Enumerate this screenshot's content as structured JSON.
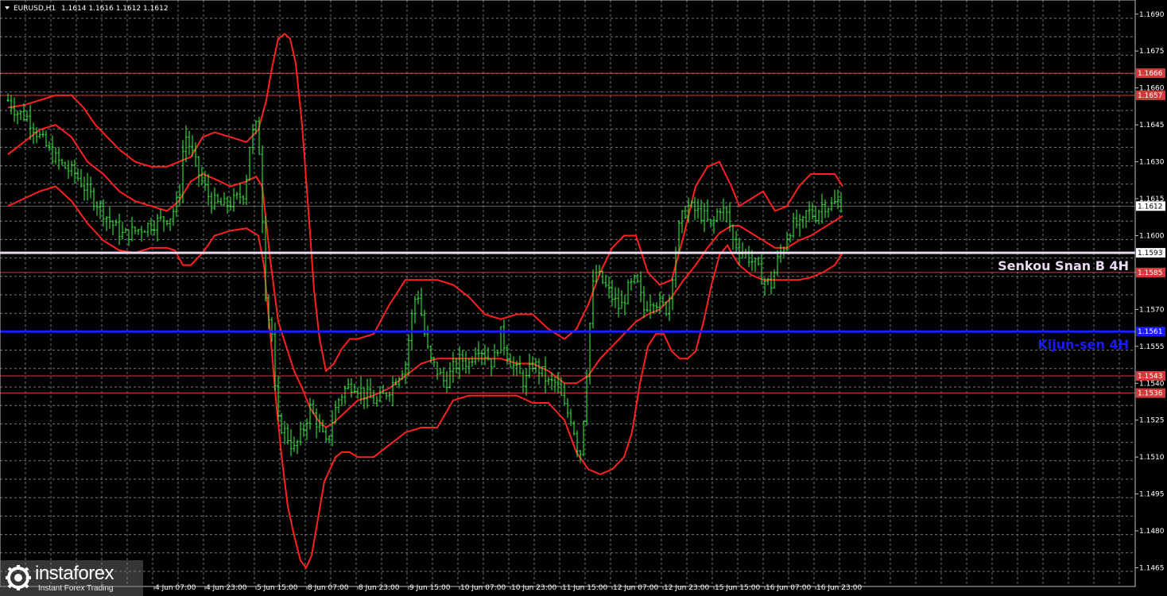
{
  "title_bar": {
    "symbol": "EURUSD,H1",
    "ohlc": "1.1614 1.1616 1.1612 1.1612"
  },
  "colors": {
    "background": "#000000",
    "grid": "#6f7a80",
    "candle": "#33ff44",
    "indicator": "#ff2020",
    "level": "#d23a3a",
    "senkou": "#e8d8f0",
    "kijun": "#1a1aff",
    "axis_text": "#ffffff"
  },
  "chart_data": {
    "type": "line",
    "symbol": "EURUSD",
    "timeframe": "H1",
    "ylim": [
      1.1463,
      1.1705
    ],
    "grid": true,
    "y_ticks": [
      "1.1690",
      "1.1675",
      "1.1660",
      "1.1645",
      "1.1630",
      "1.1615",
      "1.1600",
      "1.1585",
      "1.1570",
      "1.1555",
      "1.1540",
      "1.1525",
      "1.1510",
      "1.1495",
      "1.1480",
      "1.1465"
    ],
    "x_ticks": [
      "4 Jun 07:00",
      "4 Jun 23:00",
      "5 Jun 15:00",
      "8 Jun 07:00",
      "8 Jun 23:00",
      "9 Jun 15:00",
      "10 Jun 07:00",
      "10 Jun 23:00",
      "11 Jun 15:00",
      "12 Jun 07:00",
      "12 Jun 23:00",
      "15 Jun 15:00",
      "16 Jun 07:00",
      "16 Jun 23:00"
    ],
    "price_levels": [
      {
        "value": 1.1666,
        "label": "1.1666",
        "kind": "resistance"
      },
      {
        "value": 1.1657,
        "label": "1.1657",
        "kind": "resistance"
      },
      {
        "value": 1.1585,
        "label": "1.1585",
        "kind": "support"
      },
      {
        "value": 1.1543,
        "label": "1.1543",
        "kind": "support"
      },
      {
        "value": 1.1536,
        "label": "1.1536",
        "kind": "support"
      }
    ],
    "current_price": {
      "value": 1.1612,
      "label": "1.1612"
    },
    "senkou_span_b": {
      "value": 1.1593,
      "label": "1.1593",
      "name": "Senkou Snan B 4H"
    },
    "kijun_sen": {
      "value": 1.1561,
      "label": "1.1561",
      "name": "Kijun-sen 4H"
    },
    "price_series": {
      "x": [
        0,
        12,
        25,
        40,
        55,
        70,
        85,
        100,
        115,
        130,
        145,
        160,
        175,
        190,
        205,
        215,
        222,
        230,
        240,
        255,
        270,
        285,
        298,
        305,
        312,
        318,
        322,
        326,
        332,
        338,
        345,
        352,
        360,
        370,
        380,
        390,
        400,
        408,
        415,
        425,
        435,
        450,
        465,
        480,
        490,
        500,
        510,
        515,
        520,
        525,
        530,
        540,
        550,
        560,
        570,
        580,
        590,
        600,
        610,
        620,
        630,
        640,
        650,
        660,
        670,
        680,
        690,
        700,
        710,
        715,
        720,
        725,
        730,
        735,
        740,
        750,
        760,
        770,
        780,
        790,
        800,
        810,
        820,
        830,
        838,
        845,
        855,
        865,
        875,
        885,
        895,
        905,
        912,
        920,
        930,
        940,
        950,
        960,
        968,
        975,
        982,
        990,
        998,
        1005,
        1015,
        1025,
        1035,
        1045,
        1050
      ],
      "y": [
        1.1655,
        1.165,
        1.1648,
        1.164,
        1.1633,
        1.1628,
        1.1625,
        1.1618,
        1.1612,
        1.1605,
        1.16,
        1.1602,
        1.1604,
        1.1606,
        1.1608,
        1.1615,
        1.1642,
        1.1635,
        1.1625,
        1.1614,
        1.1612,
        1.1614,
        1.1618,
        1.164,
        1.1644,
        1.163,
        1.1585,
        1.157,
        1.156,
        1.1525,
        1.1522,
        1.1518,
        1.1513,
        1.152,
        1.153,
        1.1523,
        1.1515,
        1.1525,
        1.1533,
        1.1538,
        1.154,
        1.1535,
        1.1532,
        1.1538,
        1.1543,
        1.1548,
        1.1572,
        1.1578,
        1.1568,
        1.1558,
        1.155,
        1.1545,
        1.154,
        1.1546,
        1.155,
        1.1548,
        1.1556,
        1.1552,
        1.1548,
        1.156,
        1.155,
        1.1545,
        1.154,
        1.1548,
        1.1545,
        1.154,
        1.154,
        1.153,
        1.1525,
        1.1515,
        1.1512,
        1.153,
        1.1555,
        1.1578,
        1.1585,
        1.158,
        1.1575,
        1.157,
        1.1578,
        1.1582,
        1.157,
        1.1575,
        1.1572,
        1.157,
        1.159,
        1.1605,
        1.1612,
        1.161,
        1.1608,
        1.1603,
        1.1612,
        1.1608,
        1.1598,
        1.1595,
        1.1592,
        1.1588,
        1.1582,
        1.158,
        1.159,
        1.1595,
        1.1602,
        1.1605,
        1.1603,
        1.161,
        1.1608,
        1.1613,
        1.1612,
        1.1614,
        1.1612
      ]
    },
    "indicator_lines": [
      {
        "x": [
          0,
          20,
          40,
          60,
          80,
          95,
          110,
          125,
          140,
          160,
          180,
          200,
          215,
          230,
          245,
          260,
          280,
          300,
          315,
          325,
          332,
          340,
          348,
          355,
          362,
          370,
          378,
          385,
          392,
          400,
          410,
          420,
          430,
          440,
          460,
          480,
          500,
          520,
          540,
          560,
          580,
          600,
          620,
          640,
          660,
          680,
          700,
          715,
          730,
          745,
          760,
          775,
          790,
          805,
          820,
          835,
          850,
          865,
          880,
          895,
          910,
          920,
          935,
          950,
          965,
          980,
          995,
          1010,
          1025,
          1040,
          1050
        ],
        "y": [
          1.1652,
          1.1653,
          1.1655,
          1.1657,
          1.1657,
          1.1652,
          1.1645,
          1.164,
          1.1635,
          1.163,
          1.1628,
          1.1628,
          1.163,
          1.1632,
          1.164,
          1.1642,
          1.164,
          1.1638,
          1.1643,
          1.1655,
          1.1668,
          1.168,
          1.1682,
          1.168,
          1.167,
          1.1645,
          1.161,
          1.1578,
          1.1558,
          1.1545,
          1.1548,
          1.1554,
          1.1558,
          1.1558,
          1.156,
          1.1572,
          1.1582,
          1.1582,
          1.1582,
          1.158,
          1.1575,
          1.1568,
          1.1566,
          1.1568,
          1.1568,
          1.1562,
          1.1558,
          1.1562,
          1.1572,
          1.1585,
          1.1595,
          1.16,
          1.16,
          1.1585,
          1.158,
          1.1582,
          1.16,
          1.162,
          1.1628,
          1.163,
          1.162,
          1.1612,
          1.1615,
          1.1618,
          1.161,
          1.1612,
          1.162,
          1.1625,
          1.1625,
          1.1625,
          1.162
        ]
      },
      {
        "x": [
          0,
          20,
          40,
          60,
          80,
          100,
          120,
          140,
          160,
          180,
          200,
          215,
          230,
          245,
          260,
          280,
          300,
          312,
          320,
          330,
          340,
          350,
          360,
          370,
          380,
          390,
          400,
          410,
          420,
          440,
          460,
          480,
          500,
          520,
          540,
          560,
          580,
          600,
          620,
          640,
          660,
          680,
          700,
          715,
          730,
          745,
          760,
          775,
          790,
          805,
          820,
          835,
          850,
          865,
          880,
          895,
          910,
          920,
          935,
          950,
          965,
          980,
          995,
          1010,
          1025,
          1040,
          1050
        ],
        "y": [
          1.1633,
          1.1638,
          1.1643,
          1.1645,
          1.164,
          1.163,
          1.1625,
          1.1618,
          1.1614,
          1.1612,
          1.161,
          1.1614,
          1.1622,
          1.1625,
          1.1623,
          1.162,
          1.1622,
          1.1624,
          1.162,
          1.159,
          1.1565,
          1.1555,
          1.1545,
          1.1538,
          1.153,
          1.1525,
          1.1522,
          1.1524,
          1.1527,
          1.1533,
          1.1535,
          1.1538,
          1.1543,
          1.1548,
          1.155,
          1.155,
          1.155,
          1.155,
          1.155,
          1.1548,
          1.1548,
          1.1545,
          1.154,
          1.154,
          1.1543,
          1.155,
          1.1555,
          1.156,
          1.1565,
          1.1568,
          1.157,
          1.1575,
          1.1582,
          1.1588,
          1.1595,
          1.1601,
          1.1604,
          1.1604,
          1.1601,
          1.1598,
          1.1595,
          1.1595,
          1.1598,
          1.16,
          1.1603,
          1.1606,
          1.1608
        ]
      },
      {
        "x": [
          0,
          20,
          40,
          60,
          80,
          100,
          120,
          140,
          160,
          180,
          200,
          210,
          220,
          230,
          245,
          260,
          280,
          300,
          315,
          322,
          330,
          338,
          345,
          352,
          360,
          368,
          375,
          382,
          390,
          398,
          405,
          412,
          420,
          430,
          440,
          460,
          480,
          500,
          520,
          540,
          560,
          580,
          600,
          620,
          640,
          660,
          680,
          700,
          715,
          730,
          745,
          760,
          775,
          785,
          795,
          805,
          815,
          825,
          835,
          845,
          855,
          865,
          875,
          885,
          895,
          905,
          912,
          920,
          935,
          950,
          965,
          980,
          995,
          1010,
          1025,
          1040,
          1050
        ],
        "y": [
          1.1612,
          1.1615,
          1.1618,
          1.162,
          1.1614,
          1.1605,
          1.1598,
          1.1594,
          1.1593,
          1.1595,
          1.1595,
          1.1594,
          1.1588,
          1.1588,
          1.1593,
          1.16,
          1.1602,
          1.1603,
          1.16,
          1.1588,
          1.156,
          1.153,
          1.1508,
          1.149,
          1.1478,
          1.1468,
          1.1465,
          1.147,
          1.1485,
          1.15,
          1.1505,
          1.151,
          1.1512,
          1.1512,
          1.151,
          1.151,
          1.1515,
          1.152,
          1.1522,
          1.1522,
          1.1533,
          1.1535,
          1.1535,
          1.1535,
          1.1535,
          1.1532,
          1.1532,
          1.1525,
          1.1512,
          1.1505,
          1.1503,
          1.1505,
          1.151,
          1.152,
          1.154,
          1.1555,
          1.156,
          1.156,
          1.1553,
          1.155,
          1.155,
          1.1553,
          1.1565,
          1.158,
          1.1592,
          1.1596,
          1.1592,
          1.1588,
          1.1584,
          1.1582,
          1.1582,
          1.1582,
          1.1582,
          1.1583,
          1.1585,
          1.1588,
          1.1593
        ]
      }
    ]
  },
  "watermark": {
    "brand": "instaforex",
    "tagline": "Instant Forex Trading"
  }
}
